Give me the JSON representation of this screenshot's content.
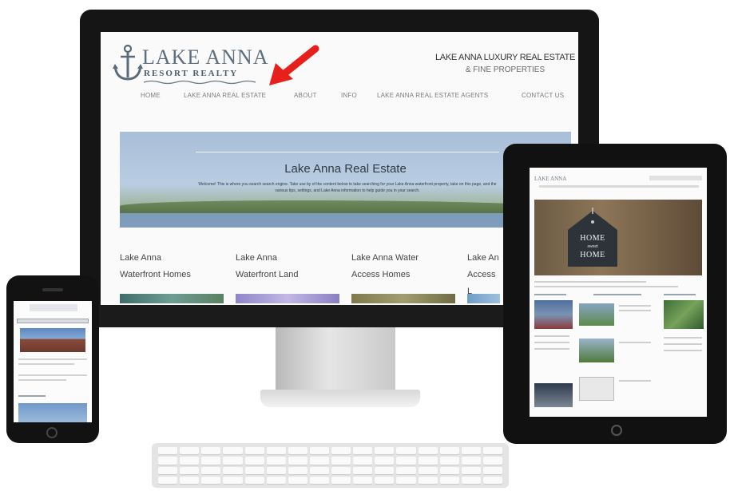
{
  "desktop_site": {
    "logo": {
      "word": "LAKE ANNA",
      "sub": "RESORT REALTY"
    },
    "tagline": {
      "line1": "LAKE ANNA LUXURY REAL ESTATE",
      "line2": "& FINE PROPERTIES"
    },
    "nav": [
      {
        "label": "HOME"
      },
      {
        "label": "LAKE ANNA REAL ESTATE"
      },
      {
        "label": "ABOUT"
      },
      {
        "label": "INFO"
      },
      {
        "label": "LAKE ANNA REAL ESTATE AGENTS"
      },
      {
        "label": "CONTACT US"
      }
    ],
    "hero": {
      "title": "Lake Anna Real Estate",
      "text": "Welcome! This is where you search search engine. Take use by of the content below to take searching for your Lake Anna waterfront property, take on this page, and the various tips, settings, and Lake Anna information to help guide you in your search."
    },
    "categories": [
      {
        "line1": "Lake Anna",
        "line2": "Waterfront Homes"
      },
      {
        "line1": "Lake Anna",
        "line2": "Waterfront Land"
      },
      {
        "line1": "Lake Anna Water",
        "line2": "Access Homes"
      },
      {
        "line1": "Lake An",
        "line2": "Access L"
      }
    ]
  },
  "tablet_site": {
    "logo": "LAKE ANNA",
    "hero_sign": {
      "line1": "HOME",
      "line2": "sweet",
      "line3": "HOME"
    }
  },
  "colors": {
    "device_frame": "#151515",
    "hero_sky": "#a9bfd8",
    "arrow": "#e8201c",
    "logo": "#5f6f7d"
  },
  "icons": [
    "anchor-icon",
    "red-arrow-icon",
    "home-button-icon"
  ]
}
